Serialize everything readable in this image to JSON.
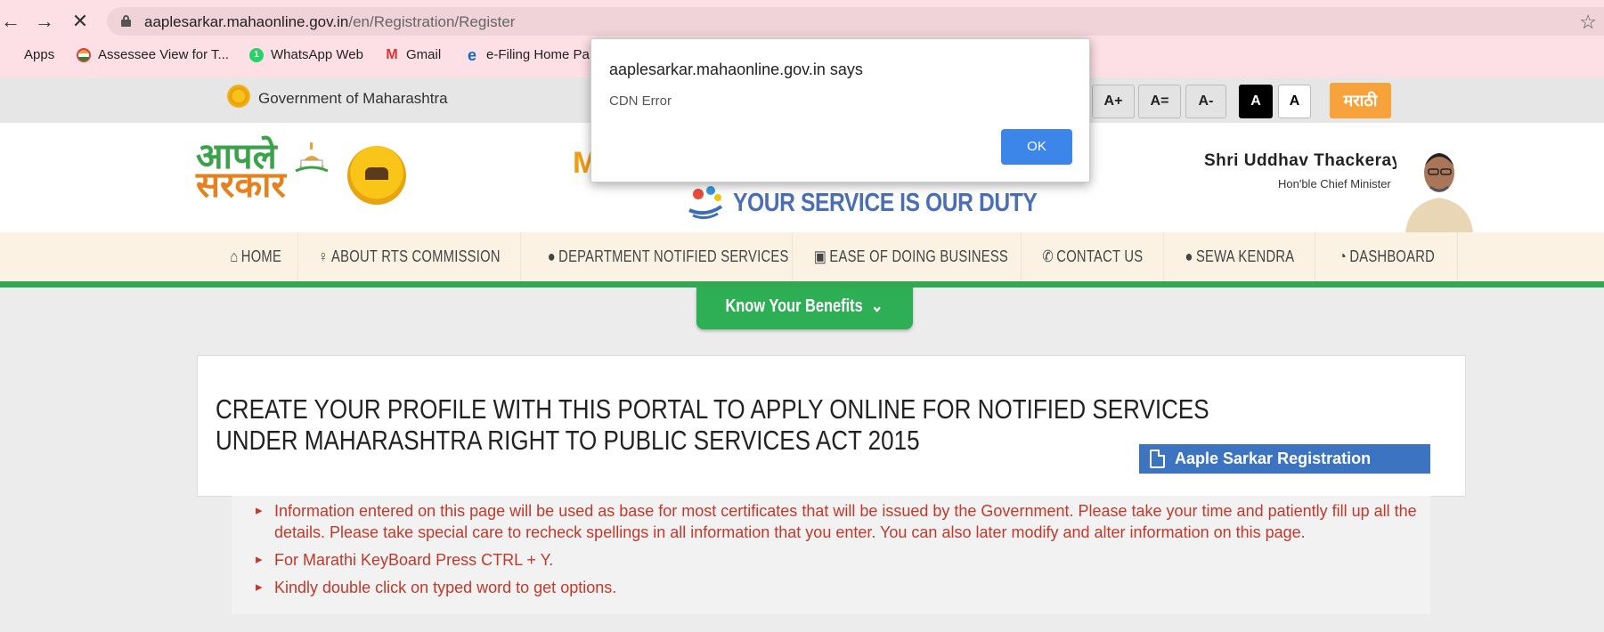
{
  "browser": {
    "url_host": "aaplesarkar.mahaonline.gov.in",
    "url_path": "/en/Registration/Register",
    "bookmarks": [
      {
        "label": "Apps",
        "icon": "apps-grid-icon"
      },
      {
        "label": "Assessee View for T...",
        "icon": "india-flag-icon"
      },
      {
        "label": "WhatsApp Web",
        "icon": "whatsapp-icon"
      },
      {
        "label": "Gmail",
        "icon": "gmail-icon"
      },
      {
        "label": "e-Filing Home Pa",
        "icon": "ie-icon"
      }
    ]
  },
  "govbar": {
    "text": "Government of Maharashtra",
    "font_buttons": [
      "A+",
      "A=",
      "A-",
      "A",
      "A"
    ],
    "language_button": "मराठी"
  },
  "header": {
    "logo_line1": "आपले",
    "logo_line2": "सरकार",
    "partial_title": "M",
    "tagline": "YOUR SERVICE IS OUR DUTY",
    "cm_name": "Shri Uddhav Thackeray",
    "cm_title": "Hon'ble Chief Minister"
  },
  "nav": {
    "items": [
      {
        "label": "HOME",
        "icon": "home-icon"
      },
      {
        "label": "ABOUT RTS COMMISSION",
        "icon": "person-icon"
      },
      {
        "label": "DEPARTMENT NOTIFIED SERVICES",
        "icon": "user-icon"
      },
      {
        "label": "EASE OF DOING BUSINESS",
        "icon": "briefcase-icon"
      },
      {
        "label": "CONTACT US",
        "icon": "phone-icon"
      },
      {
        "label": "SEWA KENDRA",
        "icon": "user-icon"
      },
      {
        "label": "DASHBOARD",
        "icon": "dashboard-icon"
      }
    ],
    "benefits_button": "Know Your Benefits"
  },
  "main": {
    "title": "CREATE YOUR PROFILE WITH THIS PORTAL TO APPLY ONLINE FOR NOTIFIED SERVICES UNDER MAHARASHTRA RIGHT TO PUBLIC SERVICES ACT 2015",
    "manual_button": "Aaple Sarkar Registration Manual",
    "info": [
      "Information entered on this page will be used as base for most certificates that will be issued by the Government. Please take your time and patiently fill up all the details. Please take special care to recheck spellings in all information that you enter. You can also later modify and alter information on this page.",
      "For Marathi KeyBoard Press CTRL + Y.",
      "Kindly double click on typed word to get options."
    ]
  },
  "dialog": {
    "title": "aaplesarkar.mahaonline.gov.in says",
    "message": "CDN Error",
    "ok": "OK"
  },
  "colors": {
    "chrome_bg": "#fde0e6",
    "nav_accent": "#33a852",
    "info_text": "#c0392b",
    "manual_btn": "#3c74c2",
    "marathi_btn": "#f7a23a"
  }
}
